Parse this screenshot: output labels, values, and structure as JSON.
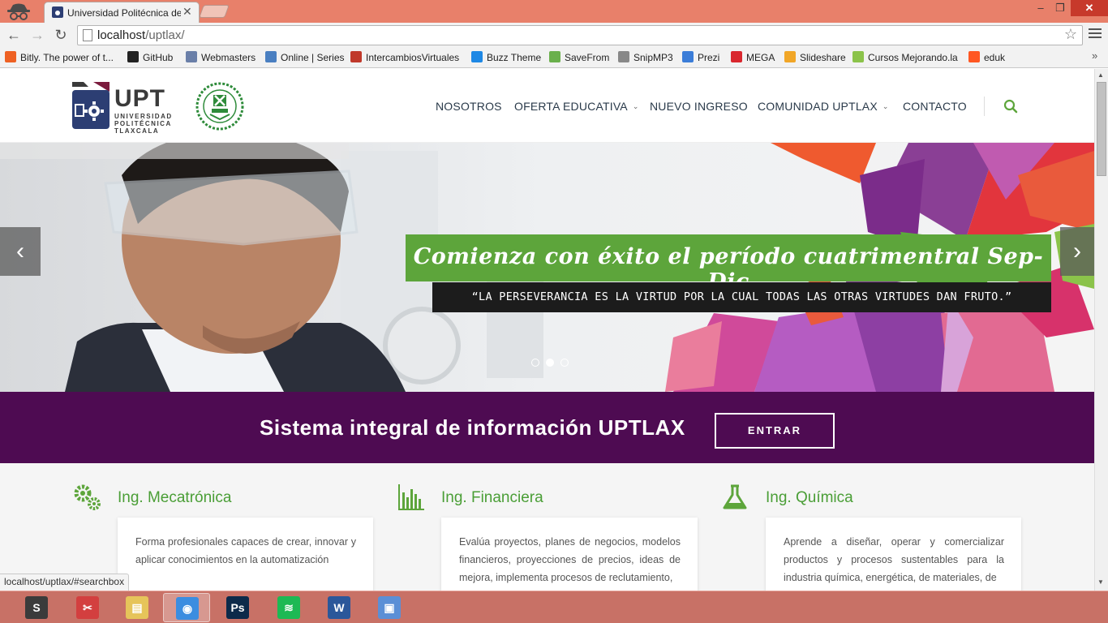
{
  "browser": {
    "tab_title": "Universidad Politécnica de",
    "tab_close": "✕",
    "window_min": "–",
    "window_max": "❐",
    "window_close": "✕",
    "url_host": "localhost",
    "url_path": "/uptlax/",
    "back": "←",
    "forward": "→",
    "reload": "↻",
    "star": "☆"
  },
  "bookmarks": [
    {
      "label": "Bitly. The power of t...",
      "icon_color": "#ee6123"
    },
    {
      "label": "GitHub",
      "icon_color": "#222222"
    },
    {
      "label": "Webmasters",
      "icon_color": "#6a7fa8"
    },
    {
      "label": "Online | Series",
      "icon_color": "#4a7fc1"
    },
    {
      "label": "IntercambiosVirtuales",
      "icon_color": "#c0392b"
    },
    {
      "label": "Buzz Theme",
      "icon_color": "#1e88e5"
    },
    {
      "label": "SaveFrom",
      "icon_color": "#6ab04c"
    },
    {
      "label": "SnipMP3",
      "icon_color": "#888888"
    },
    {
      "label": "Prezi",
      "icon_color": "#3b7dd8"
    },
    {
      "label": "MEGA",
      "icon_color": "#d9272e"
    },
    {
      "label": "Slideshare",
      "icon_color": "#f1a627"
    },
    {
      "label": "Cursos Mejorando.la",
      "icon_color": "#8bc34a"
    },
    {
      "label": "eduk",
      "icon_color": "#ff5722"
    }
  ],
  "bookmarks_more": "»",
  "site": {
    "logo_word": "UPT",
    "logo_sub": "UNIVERSIDAD POLITÉCNICA TLAXCALA",
    "nav": [
      {
        "label": "NOSOTROS",
        "caret": ""
      },
      {
        "label": "OFERTA EDUCATIVA",
        "caret": "⌄"
      },
      {
        "label": "NUEVO INGRESO",
        "caret": ""
      },
      {
        "label": "COMUNIDAD UPTLAX",
        "caret": "⌄"
      },
      {
        "label": "CONTACTO",
        "caret": ""
      }
    ]
  },
  "slider": {
    "title": "Comienza con éxito el período cuatrimentral Sep-Dic",
    "quote": "“LA PERSEVERANCIA ES LA VIRTUD POR LA CUAL TODAS LAS OTRAS VIRTUDES DAN FRUTO.”",
    "prev": "‹",
    "next": "›",
    "active_dot": 1,
    "dot_count": 3
  },
  "band": {
    "title": "Sistema integral de información UPTLAX",
    "button": "ENTRAR"
  },
  "programs": [
    {
      "title": "Ing. Mecatrónica",
      "icon": "gears-icon",
      "text": "Forma profesionales capaces de crear, innovar y aplicar conocimientos en la automatización"
    },
    {
      "title": "Ing. Financiera",
      "icon": "bar-chart-icon",
      "text": "Evalúa proyectos, planes de negocios, modelos financieros, proyecciones de precios, ideas de mejora, implementa procesos de reclutamiento,"
    },
    {
      "title": "Ing. Química",
      "icon": "flask-icon",
      "text": "Aprende a diseñar, operar y comercializar productos y procesos sustentables para la industria química, energética, de materiales, de"
    }
  ],
  "status_url": "localhost/uptlax/#searchbox",
  "taskbar": [
    {
      "app": "sublime-text",
      "glyph": "S",
      "color": "#3b3b3b",
      "active": false
    },
    {
      "app": "snipping-tool",
      "glyph": "✂",
      "color": "#d33f3f",
      "active": false
    },
    {
      "app": "file-explorer",
      "glyph": "▤",
      "color": "#e6c45a",
      "active": false
    },
    {
      "app": "chrome",
      "glyph": "◉",
      "color": "#3c8de0",
      "active": true
    },
    {
      "app": "photoshop",
      "glyph": "Ps",
      "color": "#0d2a4a",
      "active": false
    },
    {
      "app": "spotify",
      "glyph": "≋",
      "color": "#1db954",
      "active": false
    },
    {
      "app": "word",
      "glyph": "W",
      "color": "#2b579a",
      "active": false
    },
    {
      "app": "control-panel",
      "glyph": "▣",
      "color": "#5b8fd6",
      "active": false
    }
  ],
  "colors": {
    "accent_green": "#5da53b",
    "band_purple": "#4e0b52",
    "chrome_frame": "#e8806a",
    "taskbar": "#c87166"
  }
}
